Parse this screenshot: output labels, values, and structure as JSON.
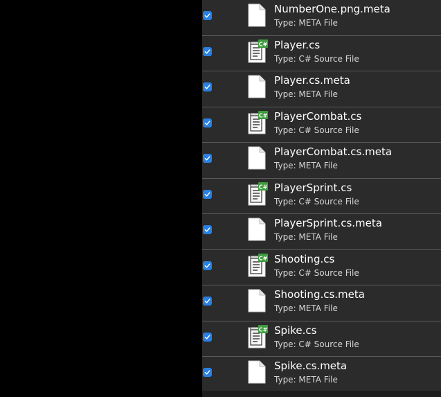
{
  "files": [
    {
      "name": "NumberOne.png.meta",
      "type": "Type: META File",
      "icon": "generic-file-icon",
      "checked": true
    },
    {
      "name": "Player.cs",
      "type": "Type: C# Source File",
      "icon": "csharp-file-icon",
      "checked": true
    },
    {
      "name": "Player.cs.meta",
      "type": "Type: META File",
      "icon": "generic-file-icon",
      "checked": true
    },
    {
      "name": "PlayerCombat.cs",
      "type": "Type: C# Source File",
      "icon": "csharp-file-icon",
      "checked": true
    },
    {
      "name": "PlayerCombat.cs.meta",
      "type": "Type: META File",
      "icon": "generic-file-icon",
      "checked": true
    },
    {
      "name": "PlayerSprint.cs",
      "type": "Type: C# Source File",
      "icon": "csharp-file-icon",
      "checked": true
    },
    {
      "name": "PlayerSprint.cs.meta",
      "type": "Type: META File",
      "icon": "generic-file-icon",
      "checked": true
    },
    {
      "name": "Shooting.cs",
      "type": "Type: C# Source File",
      "icon": "csharp-file-icon",
      "checked": true
    },
    {
      "name": "Shooting.cs.meta",
      "type": "Type: META File",
      "icon": "generic-file-icon",
      "checked": true
    },
    {
      "name": "Spike.cs",
      "type": "Type: C# Source File",
      "icon": "csharp-file-icon",
      "checked": true
    },
    {
      "name": "Spike.cs.meta",
      "type": "Type: META File",
      "icon": "generic-file-icon",
      "checked": true
    }
  ],
  "colors": {
    "panel_background": "#2b2b2b",
    "checkbox_accent": "#2a7fe0",
    "csharp_badge": "#3e9c3e"
  }
}
